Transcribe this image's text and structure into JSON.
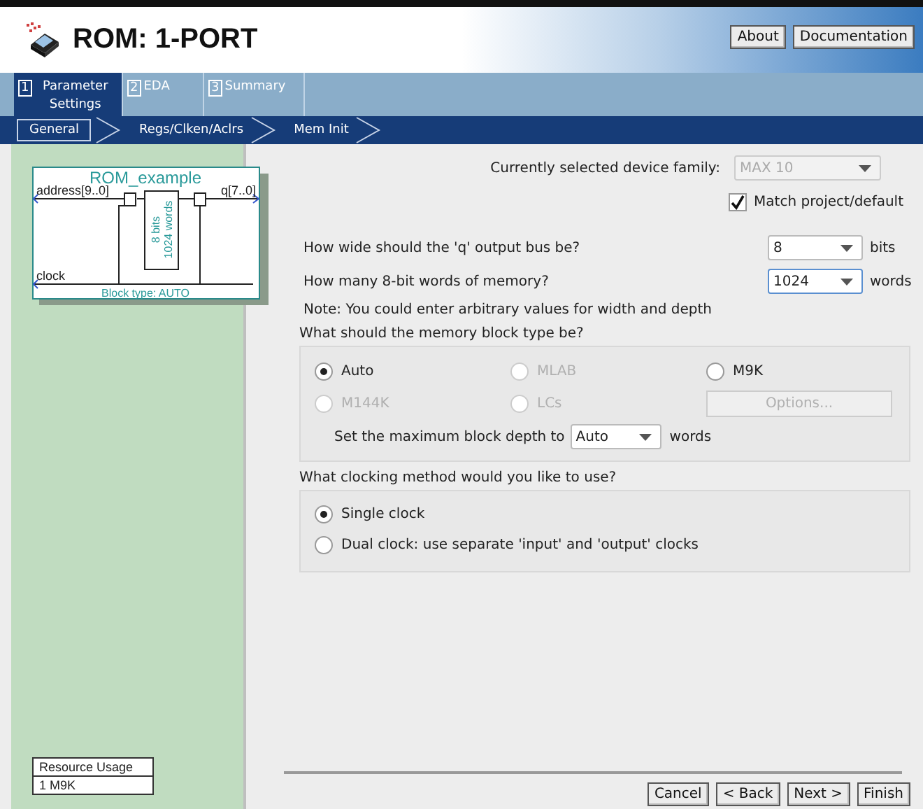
{
  "header": {
    "title": "ROM: 1-PORT",
    "buttons": [
      "About",
      "Documentation"
    ]
  },
  "steps": [
    {
      "number": "1",
      "label": "Parameter Settings",
      "selected": true
    },
    {
      "number": "2",
      "label": "EDA",
      "selected": false
    },
    {
      "number": "3",
      "label": "Summary",
      "selected": false
    }
  ],
  "subtabs": [
    {
      "label": "General",
      "selected": true
    },
    {
      "label": "Regs/Clken/Aclrs",
      "selected": false
    },
    {
      "label": "Mem Init",
      "selected": false
    }
  ],
  "diagram": {
    "title": "ROM_example",
    "input_port": "address[9..0]",
    "output_port": "q[7..0]",
    "clock_port": "clock",
    "width_label": "8 bits",
    "depth_label": "1024 words",
    "block_type": "Block type: AUTO"
  },
  "resource_usage": {
    "heading": "Resource Usage",
    "value": "1 M9K"
  },
  "device_family": {
    "label": "Currently selected device family:",
    "value": "MAX 10",
    "disabled": true
  },
  "match_default": {
    "label": "Match project/default",
    "checked": true
  },
  "size_fields": [
    {
      "label": "How wide should the 'q' output bus be?",
      "value": "8",
      "unit": "bits",
      "focused": false
    },
    {
      "label": "How many 8-bit words of memory?",
      "value": "1024",
      "unit": "words",
      "focused": true
    }
  ],
  "note": "Note: You could enter arbitrary values for width and depth",
  "block_type_section": {
    "heading": "What should the memory block type be?",
    "options": [
      {
        "label": "Auto",
        "selected": true,
        "disabled": false
      },
      {
        "label": "MLAB",
        "selected": false,
        "disabled": true
      },
      {
        "label": "M9K",
        "selected": false,
        "disabled": false
      },
      {
        "label": "M144K",
        "selected": false,
        "disabled": true
      },
      {
        "label": "LCs",
        "selected": false,
        "disabled": true
      }
    ],
    "options_button": {
      "label": "Options...",
      "disabled": true
    },
    "max_depth": {
      "label": "Set the maximum block depth to",
      "value": "Auto",
      "unit": "words"
    }
  },
  "clocking_section": {
    "heading": "What clocking method would you like to use?",
    "options": [
      {
        "label": "Single clock",
        "selected": true,
        "disabled": false
      },
      {
        "label": "Dual clock: use separate 'input' and 'output' clocks",
        "selected": false,
        "disabled": false
      }
    ]
  },
  "footer_buttons": [
    "Cancel",
    "< Back",
    "Next >",
    "Finish"
  ]
}
